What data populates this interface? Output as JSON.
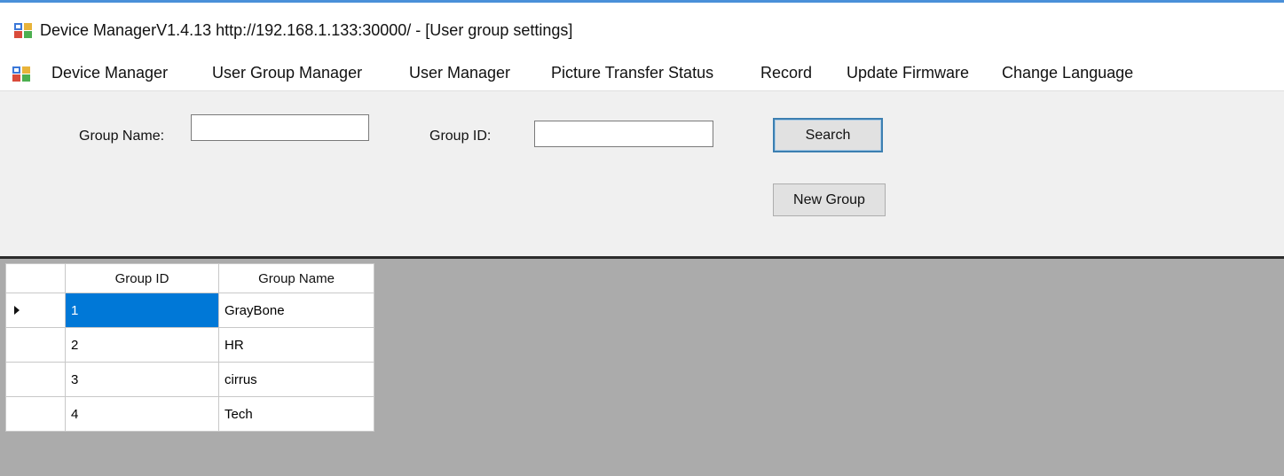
{
  "window": {
    "title": "Device ManagerV1.4.13 http://192.168.1.133:30000/ - [User group settings]",
    "icon": "app-window-icon"
  },
  "menu": {
    "icon": "mdi-child-icon",
    "items": [
      {
        "label": "Device Manager"
      },
      {
        "label": "User Group Manager"
      },
      {
        "label": "User Manager"
      },
      {
        "label": "Picture Transfer Status"
      },
      {
        "label": "Record"
      },
      {
        "label": "Update Firmware"
      },
      {
        "label": "Change Language"
      }
    ]
  },
  "search": {
    "group_name_label": "Group Name:",
    "group_name_value": "",
    "group_id_label": "Group ID:",
    "group_id_value": "",
    "search_button": "Search",
    "new_group_button": "New Group"
  },
  "grid": {
    "columns": [
      "Group ID",
      "Group Name"
    ],
    "rows": [
      {
        "id": "1",
        "name": "GrayBone",
        "current": true
      },
      {
        "id": "2",
        "name": "HR",
        "current": false
      },
      {
        "id": "3",
        "name": "cirrus",
        "current": false
      },
      {
        "id": "4",
        "name": "Tech",
        "current": false
      }
    ]
  },
  "colors": {
    "selection": "#0078d7",
    "panel": "#f0f0f0",
    "grid_background": "#ababab",
    "title_accent": "#4a90d9"
  }
}
